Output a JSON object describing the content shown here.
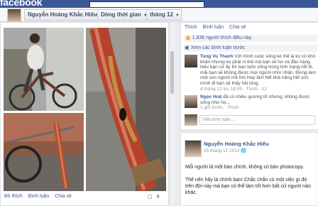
{
  "app": {
    "logo": "facebook"
  },
  "timeline_bar": {
    "profile_name": "Nguyễn Hoàng Khắc Hiếu",
    "timeline_label": "Dòng thời gian",
    "month_label": "tháng 12"
  },
  "left_post": {
    "actions": [
      "Bỏ thích",
      "Bình luận",
      "Chia sẻ"
    ],
    "comment_count": "9"
  },
  "right_top": {
    "actions": [
      "Thích",
      "Bình luận",
      "Chia sẻ"
    ],
    "likes": "1.836 người thích điều này.",
    "view_previous": "Xem các bình luận trước",
    "comments": [
      {
        "name": "Tung Vu Thanh",
        "text": "Với mình cuộc sống kẻ thế là kọ có khó khăn nhưng kọ phải vì thế mà bạn sẽ hư và đầu hàng. Nếu bạn cứ ấy thì bạn luôn sống trong tình trạng nổi lề, mãi bạn sẽ không được mọi người nhìn nhận. Đừng làm một con người mê lờn Hay lâm hết khả năng hết sức mình đi bạn sẽ thấy hài lòng.",
        "meta": "4 tháng 12 lúc 18:09 · Thích · 12"
      },
      {
        "name": "Ngọc Huệ",
        "text": "đã có nhiều gương tỡ nhưng, không được sống như họ...",
        "meta": "1 giờ trước · Thích"
      }
    ],
    "write_comment_placeholder": "Viết bình luận..."
  },
  "right_post": {
    "author": "Nguyễn Hoàng Khắc Hiếu",
    "date": "25 tháng 12 2012",
    "line1": "Mỗi người là một bản chính, không có bản photocopy.",
    "line2": "Thế nên hãy là chính bạn! Chắc chắn có một việc gì đó trên đời này mà bạn có thể làm tốt hơn bất cứ người nào khác."
  }
}
